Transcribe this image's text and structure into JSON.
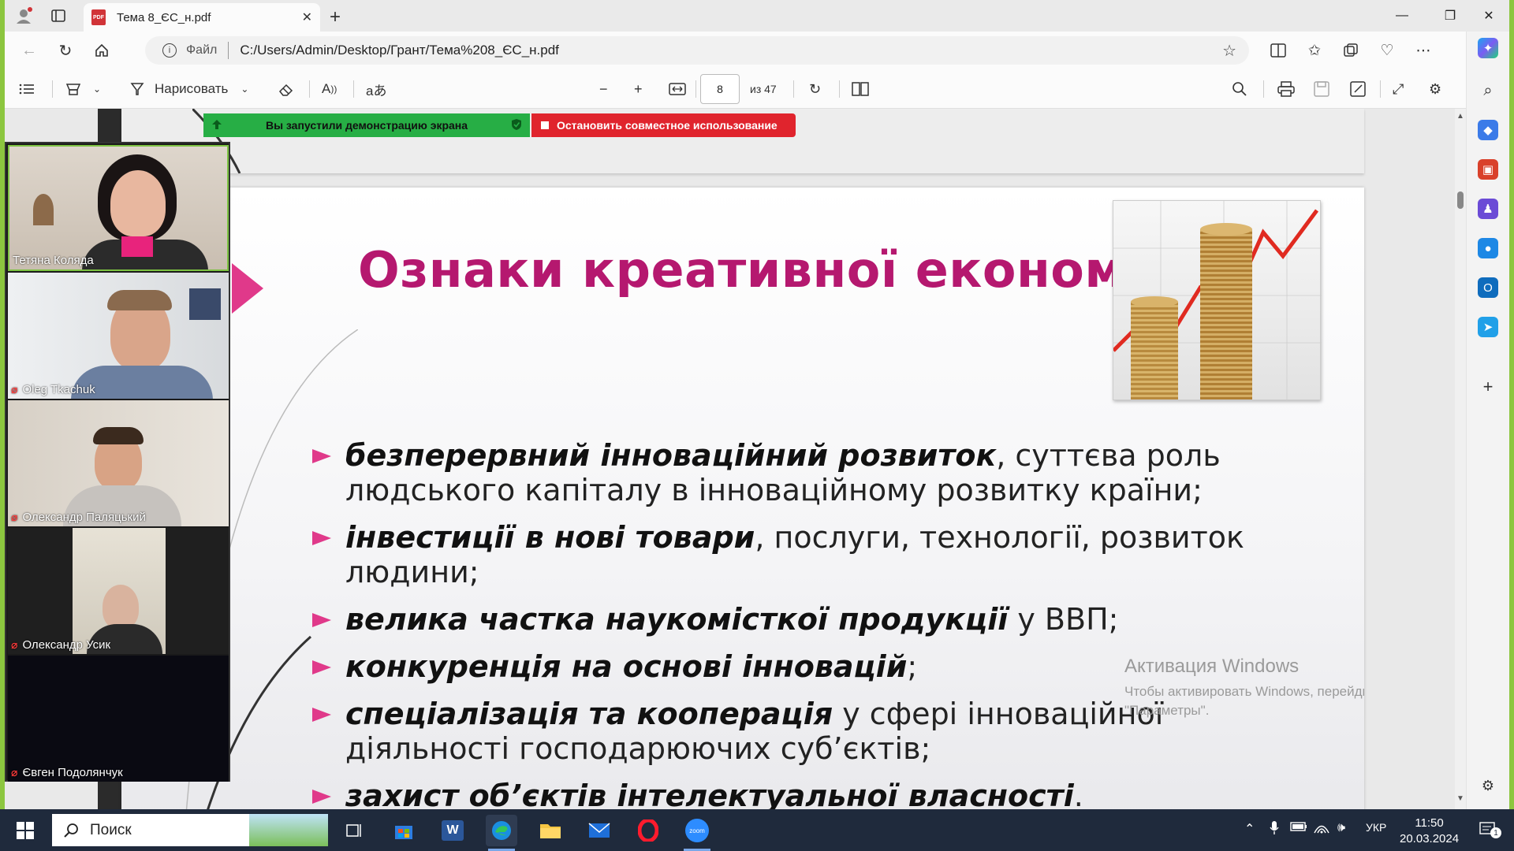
{
  "browser": {
    "tab_title": "Тема 8_ЄС_н.pdf",
    "tab_pdf_badge": "PDF",
    "address_label": "Файл",
    "url": "C:/Users/Admin/Desktop/Грант/Тема%208_ЄС_н.pdf"
  },
  "pdf_toolbar": {
    "draw_label": "Нарисовать",
    "page_current": "8",
    "page_total": "из 47"
  },
  "share_bar": {
    "started_label": "Вы запустили демонстрацию экрана",
    "stop_label": "Остановить совместное использование"
  },
  "slide": {
    "title": "Ознаки креативної економіки",
    "bullets": [
      {
        "bold": "безперервний інноваційний розвиток",
        "rest": ", суттєва   роль людського капіталу в інноваційному розвитку країни;"
      },
      {
        "bold": "інвестиції в нові товари",
        "rest": ", послуги, технології, розвиток людини;"
      },
      {
        "bold": "велика частка наукомісткої продукції",
        "rest": " у ВВП;"
      },
      {
        "bold": "конкуренція на основі інновацій",
        "rest": ";"
      },
      {
        "bold": "спеціалізація та кооперація",
        "rest": " у сфері інноваційної діяльності господарюючих суб’єктів;"
      },
      {
        "bold": "захист об’єктів інтелектуальної власності",
        "rest": "."
      }
    ]
  },
  "watermark": {
    "line1": "Активация Windows",
    "line2": "Чтобы активировать Windows, перейдите в раздел \"Параметры\"."
  },
  "participants": [
    {
      "name": "Тетяна Коляда",
      "muted": false
    },
    {
      "name": "Oleg Tkachuk",
      "muted": true
    },
    {
      "name": "Олександр Паляцький",
      "muted": true
    },
    {
      "name": "Олександр Усик",
      "muted": true
    },
    {
      "name": "Євген Подолянчук",
      "muted": true
    }
  ],
  "taskbar": {
    "search_label": "Поиск",
    "language": "УКР",
    "time": "11:50",
    "date": "20.03.2024",
    "notification_count": "1",
    "zoom_app_label": "zoom"
  },
  "colors": {
    "accent_pink": "#e0398a",
    "title_magenta": "#b5186f",
    "share_green": "#27ae45",
    "share_red": "#e0242d",
    "outer_border": "#8cc63f"
  }
}
